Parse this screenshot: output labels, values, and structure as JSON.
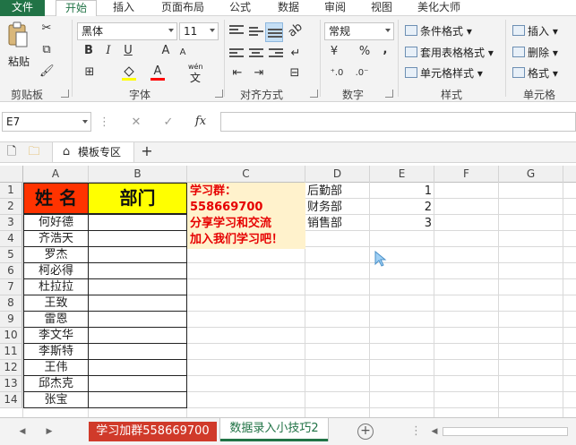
{
  "menu": {
    "file": "文件",
    "tabs": [
      "开始",
      "插入",
      "页面布局",
      "公式",
      "数据",
      "审阅",
      "视图",
      "美化大师"
    ]
  },
  "ribbon": {
    "clipboard": {
      "paste": "粘贴",
      "label": "剪贴板"
    },
    "font": {
      "name": "黑体",
      "size": "11",
      "bold": "B",
      "italic": "I",
      "underline": "U",
      "grow": "A",
      "shrink": "A",
      "color_letter": "A",
      "wen": "wén",
      "wen_char": "文",
      "label": "字体",
      "fill_color": "#ffff00",
      "font_color": "#ff0000"
    },
    "alignment": {
      "label": "对齐方式"
    },
    "number": {
      "format": "常规",
      "percent": "%",
      "comma": ",",
      "label": "数字"
    },
    "styles": {
      "conditional": "条件格式",
      "table": "套用表格格式",
      "cell": "单元格样式",
      "label": "样式"
    },
    "cells": {
      "insert": "插入",
      "delete": "删除",
      "format": "格式",
      "label": "单元格"
    }
  },
  "formula_bar": {
    "name_box": "E7",
    "cancel": "✕",
    "enter": "✓",
    "fx": "fx",
    "value": ""
  },
  "doc_tabs": {
    "template": "模板专区",
    "add": "+"
  },
  "grid": {
    "columns": [
      "A",
      "B",
      "C",
      "D",
      "E",
      "F",
      "G"
    ],
    "rows": [
      "1",
      "2",
      "3",
      "4",
      "5",
      "6",
      "7",
      "8",
      "9",
      "10",
      "11",
      "12",
      "13",
      "14"
    ],
    "header_name": "姓 名",
    "header_dept": "部门",
    "names": [
      "何好德",
      "齐浩天",
      "罗杰",
      "柯必得",
      "杜拉拉",
      "王致",
      "雷恩",
      "李文华",
      "李斯特",
      "王伟",
      "邱杰克",
      "张宝"
    ],
    "promo": [
      "学习群：",
      "558669700",
      "分享学习和交流",
      "加入我们学习吧！"
    ],
    "departments": [
      "后勤部",
      "财务部",
      "销售部"
    ],
    "dept_numbers": [
      "1",
      "2",
      "3"
    ],
    "colors": {
      "header_name_bg": "#ff3300",
      "header_dept_bg": "#ffff00",
      "promo_bg": "#fff2cc",
      "promo_text": "#e60000"
    }
  },
  "sheets": {
    "tabs": [
      "学习加群558669700",
      "数据录入小技巧2"
    ],
    "active_index": 1,
    "tab1_color": "#d03a2a",
    "add": "+",
    "more": "⋮"
  }
}
